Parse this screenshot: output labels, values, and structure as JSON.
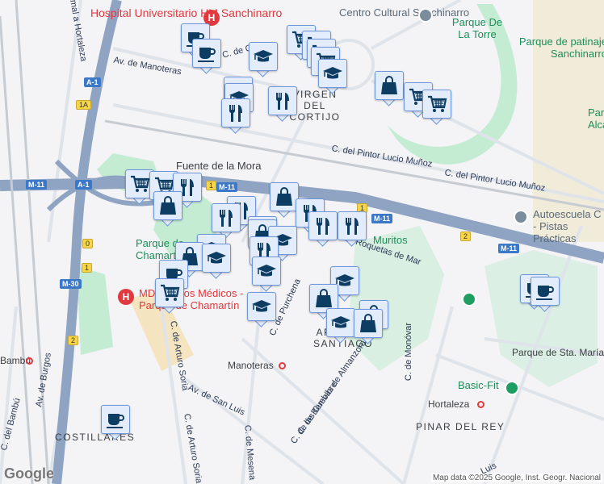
{
  "map": {
    "labels": {
      "hospital_hm": "Hospital Universitario HM Sanchinarro",
      "centro_cultural": "Centro Cultural Sanchinarro",
      "parque_torre": "Parque De La Torre",
      "parque_patinaje": "Parque de patinaje Sanchinarro",
      "parque_alcala": "Parque Alcalá",
      "av_manoteras": "Av. de Manoteras",
      "c_de_o": "C. de O",
      "virgen_cortijo": "VIRGEN DEL CORTIJO",
      "fuente_mora": "Fuente de la Mora",
      "pintor_1": "C. del Pintor Lucio Muñoz",
      "pintor_2": "C. del Pintor Lucio Muñoz",
      "autoescuela": "Autoescuela C - Pistas Prácticas",
      "muritos": "Muritos",
      "roquetas": "C. de Roquetas de Mar",
      "parque_chamartin": "Parque de Chamartín",
      "md_centros": "MD Centros Médicos - Parque de Chamartín",
      "urchena": "C. de Purchena",
      "santiago": "APÓSTOL SANTIAGO",
      "manoteras": "Manoteras",
      "cuevas": "C. de las Cuevas de Almanzora",
      "bembibre": "C. de Bembibre",
      "monovar": "C. de Monóvar",
      "sta_maria": "Parque de Sta. María",
      "basic_fit": "Basic-Fit",
      "hortaleza": "Hortaleza",
      "pinar": "PINAR DEL REY",
      "bambu": "Bambú",
      "c_bambu": "C. del Bambú",
      "av_burgos": "Av. de Burgos",
      "arturo_soria_1": "C. de Arturo Soria",
      "arturo_soria_2": "C. de Arturo Soria",
      "av_san_luis": "Av. de San Luis",
      "mesena": "C. de Mesena",
      "costillares": "COSTILLARES",
      "ramal": "Ramal a Hortaleza",
      "luis": "Luis"
    },
    "shields": {
      "a1_top": "A-1",
      "a1_mid": "A-1",
      "m11_left": "M-11",
      "m11_mid": "M-11",
      "m11_r1": "M-11",
      "m11_r2": "M-11",
      "m30": "M-30"
    },
    "exits": {
      "e1a": "1A",
      "e1": "1",
      "e1b": "1",
      "e2": "2",
      "e0": "0",
      "e1c": "1",
      "e2b": "2"
    },
    "hospital_icon": "H",
    "attribution": "Map data ©2025 Google, Inst. Geogr. Nacional",
    "logo": "Google"
  },
  "markers": [
    "cafe",
    "cafe",
    "education",
    "cart",
    "cart",
    "cart",
    "cart",
    "education",
    "education",
    "education",
    "food",
    "food",
    "bag",
    "cart",
    "cart",
    "cart",
    "cart",
    "food",
    "bag",
    "bag",
    "food",
    "food",
    "food",
    "food",
    "food",
    "food",
    "bag",
    "education",
    "education",
    "bag",
    "education",
    "food",
    "cafe",
    "education",
    "cart",
    "education",
    "education",
    "bag",
    "education",
    "bag",
    "bag",
    "cafe",
    "cafe",
    "cafe"
  ],
  "colors": {
    "marker_fill": "#e3ecfb",
    "marker_border": "#6d97da",
    "icon": "#0d3d63",
    "highway": "#8ea4c2",
    "park": "#c4ecd3",
    "hospital": "#e0393e"
  }
}
